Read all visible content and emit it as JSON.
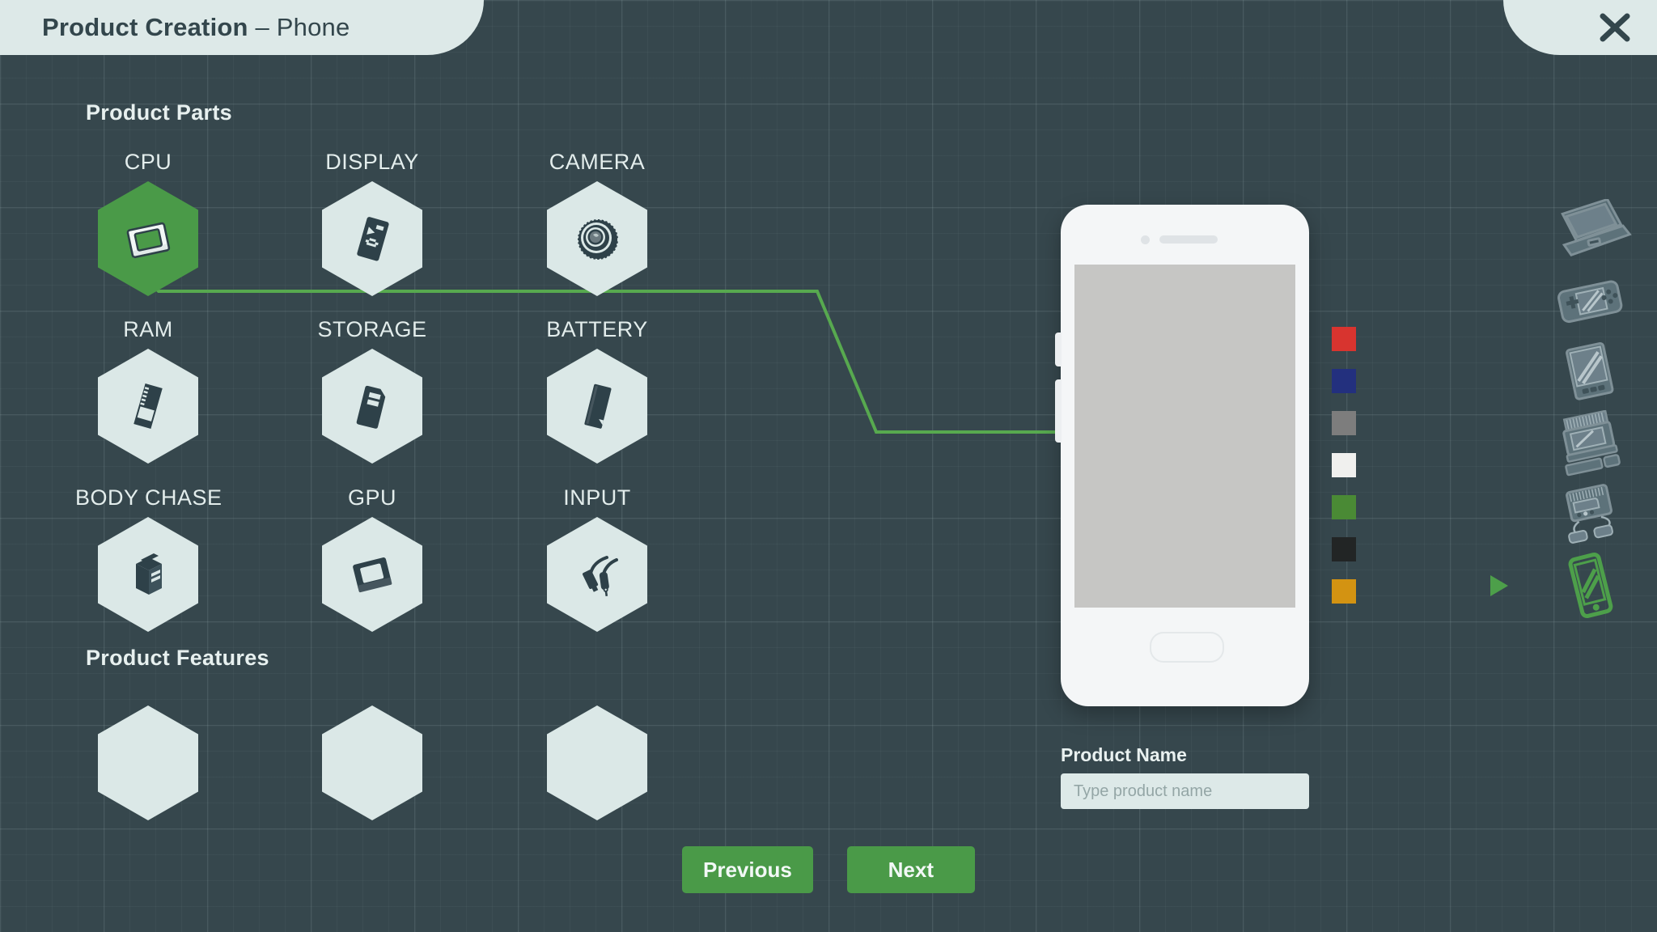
{
  "window": {
    "title_strong": "Product Creation",
    "title_separator": " – ",
    "title_light": "Phone",
    "close_icon": "close-icon"
  },
  "sections": {
    "parts_title": "Product Parts",
    "features_title": "Product Features"
  },
  "parts": [
    {
      "label": "CPU",
      "icon": "cpu-chip-icon",
      "selected": true
    },
    {
      "label": "DISPLAY",
      "icon": "display-icon",
      "selected": false
    },
    {
      "label": "CAMERA",
      "icon": "camera-lens-icon",
      "selected": false
    },
    {
      "label": "RAM",
      "icon": "ram-stick-icon",
      "selected": false
    },
    {
      "label": "STORAGE",
      "icon": "sd-card-icon",
      "selected": false
    },
    {
      "label": "BATTERY",
      "icon": "battery-icon",
      "selected": false
    },
    {
      "label": "BODY CHASE",
      "icon": "tower-case-icon",
      "selected": false
    },
    {
      "label": "GPU",
      "icon": "gpu-chip-icon",
      "selected": false
    },
    {
      "label": "INPUT",
      "icon": "cable-plug-icon",
      "selected": false
    }
  ],
  "features": [
    {
      "label": "",
      "icon": "empty-slot-icon"
    },
    {
      "label": "",
      "icon": "empty-slot-icon"
    },
    {
      "label": "",
      "icon": "empty-slot-icon"
    }
  ],
  "preview": {
    "device_icon": "phone-mockup",
    "screen_color": "#c6c6c4",
    "body_color": "#f4f6f7"
  },
  "swatches": [
    {
      "name": "red",
      "hex": "#d8342f"
    },
    {
      "name": "navy",
      "hex": "#23307e"
    },
    {
      "name": "gray",
      "hex": "#7d7d7d"
    },
    {
      "name": "white",
      "hex": "#f0f0ee"
    },
    {
      "name": "green",
      "hex": "#4a8a35"
    },
    {
      "name": "black",
      "hex": "#222525"
    },
    {
      "name": "orange",
      "hex": "#d39312"
    }
  ],
  "devices": [
    {
      "name": "laptop",
      "icon": "laptop-icon",
      "selected": false
    },
    {
      "name": "handheld console",
      "icon": "handheld-console-icon",
      "selected": false
    },
    {
      "name": "tablet",
      "icon": "tablet-icon",
      "selected": false
    },
    {
      "name": "desktop computer",
      "icon": "desktop-computer-icon",
      "selected": false
    },
    {
      "name": "game console",
      "icon": "game-console-icon",
      "selected": false
    },
    {
      "name": "phone",
      "icon": "phone-icon",
      "selected": true
    }
  ],
  "product_name": {
    "label": "Product Name",
    "placeholder": "Type product name",
    "value": ""
  },
  "footer": {
    "previous_label": "Previous",
    "next_label": "Next"
  },
  "colors": {
    "background": "#36474d",
    "panel_light": "#dde9e8",
    "accent_green": "#4a9a48",
    "connector_green": "#57a94f",
    "text_light": "#e7f0ef",
    "text_dark": "#33464c",
    "icon_dark": "#2e4149"
  }
}
